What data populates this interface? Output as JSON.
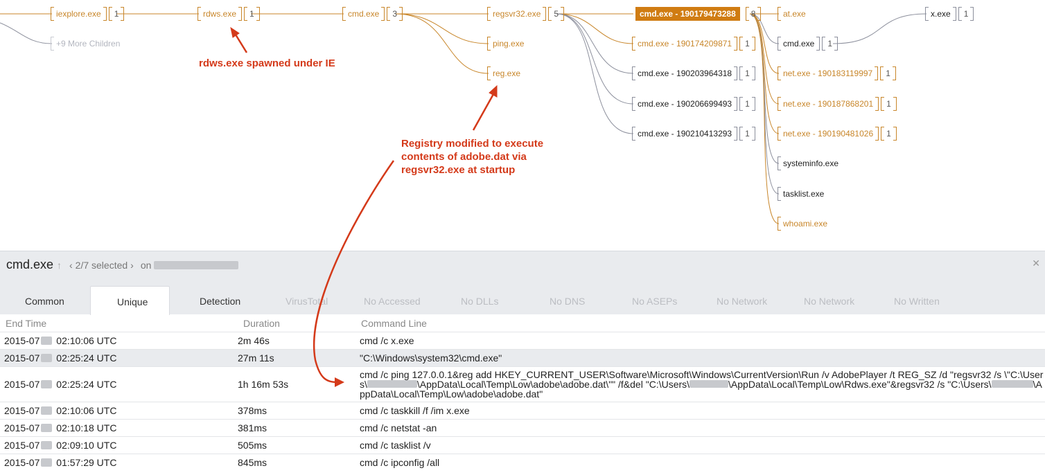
{
  "tree": {
    "nodes": [
      {
        "id": "iexplore",
        "name": "iexplore.exe",
        "count": "1",
        "style": "orange"
      },
      {
        "id": "more",
        "name": "+9 More Children",
        "count": "",
        "style": "faded"
      },
      {
        "id": "rdws",
        "name": "rdws.exe",
        "count": "1",
        "style": "orange"
      },
      {
        "id": "cmd1",
        "name": "cmd.exe",
        "count": "3",
        "style": "orange"
      },
      {
        "id": "regsvr",
        "name": "regsvr32.exe",
        "count": "5",
        "style": "orange"
      },
      {
        "id": "ping",
        "name": "ping.exe",
        "count": "",
        "style": "orange"
      },
      {
        "id": "reg",
        "name": "reg.exe",
        "count": "",
        "style": "orange"
      },
      {
        "id": "cmdsel",
        "name": "cmd.exe - 190179473288",
        "count": "8",
        "style": "selected"
      },
      {
        "id": "cmda",
        "name": "cmd.exe - 190174209871",
        "count": "1",
        "style": "orange"
      },
      {
        "id": "cmdb",
        "name": "cmd.exe - 190203964318",
        "count": "1",
        "style": "gray"
      },
      {
        "id": "cmdc",
        "name": "cmd.exe - 190206699493",
        "count": "1",
        "style": "gray"
      },
      {
        "id": "cmdd",
        "name": "cmd.exe - 190210413293",
        "count": "1",
        "style": "gray"
      },
      {
        "id": "at",
        "name": "at.exe",
        "count": "",
        "style": "orange"
      },
      {
        "id": "cmde",
        "name": "cmd.exe",
        "count": "1",
        "style": "gray"
      },
      {
        "id": "net1",
        "name": "net.exe - 190183119997",
        "count": "1",
        "style": "orange"
      },
      {
        "id": "net2",
        "name": "net.exe - 190187868201",
        "count": "1",
        "style": "orange"
      },
      {
        "id": "net3",
        "name": "net.exe - 190190481026",
        "count": "1",
        "style": "orange"
      },
      {
        "id": "sysinfo",
        "name": "systeminfo.exe",
        "count": "",
        "style": "gray"
      },
      {
        "id": "tasklist",
        "name": "tasklist.exe",
        "count": "",
        "style": "gray"
      },
      {
        "id": "whoami",
        "name": "whoami.exe",
        "count": "",
        "style": "orange"
      },
      {
        "id": "x",
        "name": "x.exe",
        "count": "1",
        "style": "gray"
      }
    ]
  },
  "annotations": {
    "rdws": "rdws.exe spawned under IE",
    "registry_line1": "Registry modified to execute",
    "registry_line2": "contents of adobe.dat via",
    "registry_line3": "regsvr32.exe at startup"
  },
  "colors": {
    "accent": "#c8862a",
    "selected": "#d07c12",
    "annotation": "#d43a1a",
    "gray_link": "#8c8f9c"
  },
  "panel": {
    "title": "cmd.exe",
    "up_icon": "up-arrow-icon",
    "selection": "2/7 selected",
    "on_label": "on",
    "close_icon": "close-icon",
    "tabs": [
      {
        "label": "Common",
        "enabled": true
      },
      {
        "label": "Unique",
        "enabled": true,
        "active": true
      },
      {
        "label": "Detection",
        "enabled": true
      },
      {
        "label": "VirusTotal",
        "enabled": false
      },
      {
        "label": "No Accessed",
        "enabled": false
      },
      {
        "label": "No DLLs",
        "enabled": false
      },
      {
        "label": "No DNS",
        "enabled": false
      },
      {
        "label": "No ASEPs",
        "enabled": false
      },
      {
        "label": "No Network",
        "enabled": false
      },
      {
        "label": "No Network",
        "enabled": false
      },
      {
        "label": "No Written",
        "enabled": false
      }
    ],
    "columns": [
      "End Time",
      "Duration",
      "Command Line"
    ],
    "rows": [
      {
        "date": "2015-07",
        "time": "02:10:06 UTC",
        "duration": "2m 46s",
        "command": "cmd /c x.exe"
      },
      {
        "date": "2015-07",
        "time": "02:25:24 UTC",
        "duration": "27m 11s",
        "command": "\"C:\\Windows\\system32\\cmd.exe\""
      },
      {
        "date": "2015-07",
        "time": "02:25:24 UTC",
        "duration": "1h 16m 53s",
        "cmd_a": "cmd /c ping 127.0.0.1&reg add HKEY_CURRENT_USER\\Software\\Microsoft\\Windows\\CurrentVersion\\Run /v AdobePlayer /t REG_SZ /d \"regsvr32 /s \\\"C:\\User",
        "cmd_b1": "s\\",
        "cmd_b2": "\\AppData\\Local\\Temp\\Low\\adobe\\adobe.dat\\\"\" /f&del \"C:\\Users\\",
        "cmd_b3": "\\AppData\\Local\\Temp\\Low\\Rdws.exe\"&regsvr32 /s \"C:\\Users\\",
        "cmd_b4": "\\A",
        "cmd_c": "ppData\\Local\\Temp\\Low\\adobe\\adobe.dat\""
      },
      {
        "date": "2015-07",
        "time": "02:10:06 UTC",
        "duration": "378ms",
        "command": "cmd /c taskkill /f /im x.exe"
      },
      {
        "date": "2015-07",
        "time": "02:10:18 UTC",
        "duration": "381ms",
        "command": "cmd /c netstat -an"
      },
      {
        "date": "2015-07",
        "time": "02:09:10 UTC",
        "duration": "505ms",
        "command": "cmd /c tasklist /v"
      },
      {
        "date": "2015-07",
        "time": "01:57:29 UTC",
        "duration": "845ms",
        "command": "cmd /c ipconfig /all"
      }
    ]
  }
}
